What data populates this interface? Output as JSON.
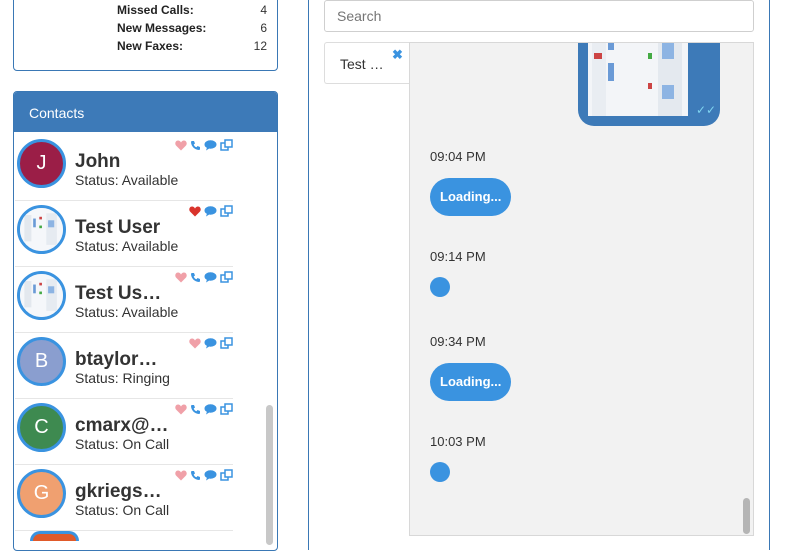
{
  "stats": [
    {
      "label": "Missed Calls:",
      "value": "4"
    },
    {
      "label": "New Messages:",
      "value": "6"
    },
    {
      "label": "New Faxes:",
      "value": "12"
    }
  ],
  "contacts": {
    "title": "Contacts",
    "items": [
      {
        "initial": "J",
        "name": "John",
        "status": "Status: Available",
        "avatar_color": "#9b1e47",
        "favorite": false,
        "has_call": true
      },
      {
        "initial": "",
        "name": "Test User",
        "status": "Status: Available",
        "avatar_color": "",
        "favorite": true,
        "has_call": false
      },
      {
        "initial": "",
        "name": "Test Us…",
        "status": "Status: Available",
        "avatar_color": "",
        "favorite": false,
        "has_call": true
      },
      {
        "initial": "B",
        "name": "btaylor…",
        "status": "Status: Ringing",
        "avatar_color": "#8a9ecf",
        "favorite": false,
        "has_call": false
      },
      {
        "initial": "C",
        "name": "cmarx@…",
        "status": "Status: On Call",
        "avatar_color": "#3e8a50",
        "favorite": false,
        "has_call": true
      },
      {
        "initial": "G",
        "name": "gkriegs…",
        "status": "Status: On Call",
        "avatar_color": "#f0a070",
        "favorite": false,
        "has_call": true
      }
    ]
  },
  "search": {
    "placeholder": "Search"
  },
  "conversation_tab": {
    "label": "Test …"
  },
  "messages": [
    {
      "time": "09:04 PM",
      "text": "Loading..."
    },
    {
      "time": "09:14 PM",
      "text": ""
    },
    {
      "time": "09:34 PM",
      "text": "Loading..."
    },
    {
      "time": "10:03 PM",
      "text": ""
    }
  ],
  "colors": {
    "accent": "#3d7ab8",
    "bubble": "#3a93e0",
    "favorite_on": "#d9332b",
    "favorite_off": "#f0a0a8"
  }
}
